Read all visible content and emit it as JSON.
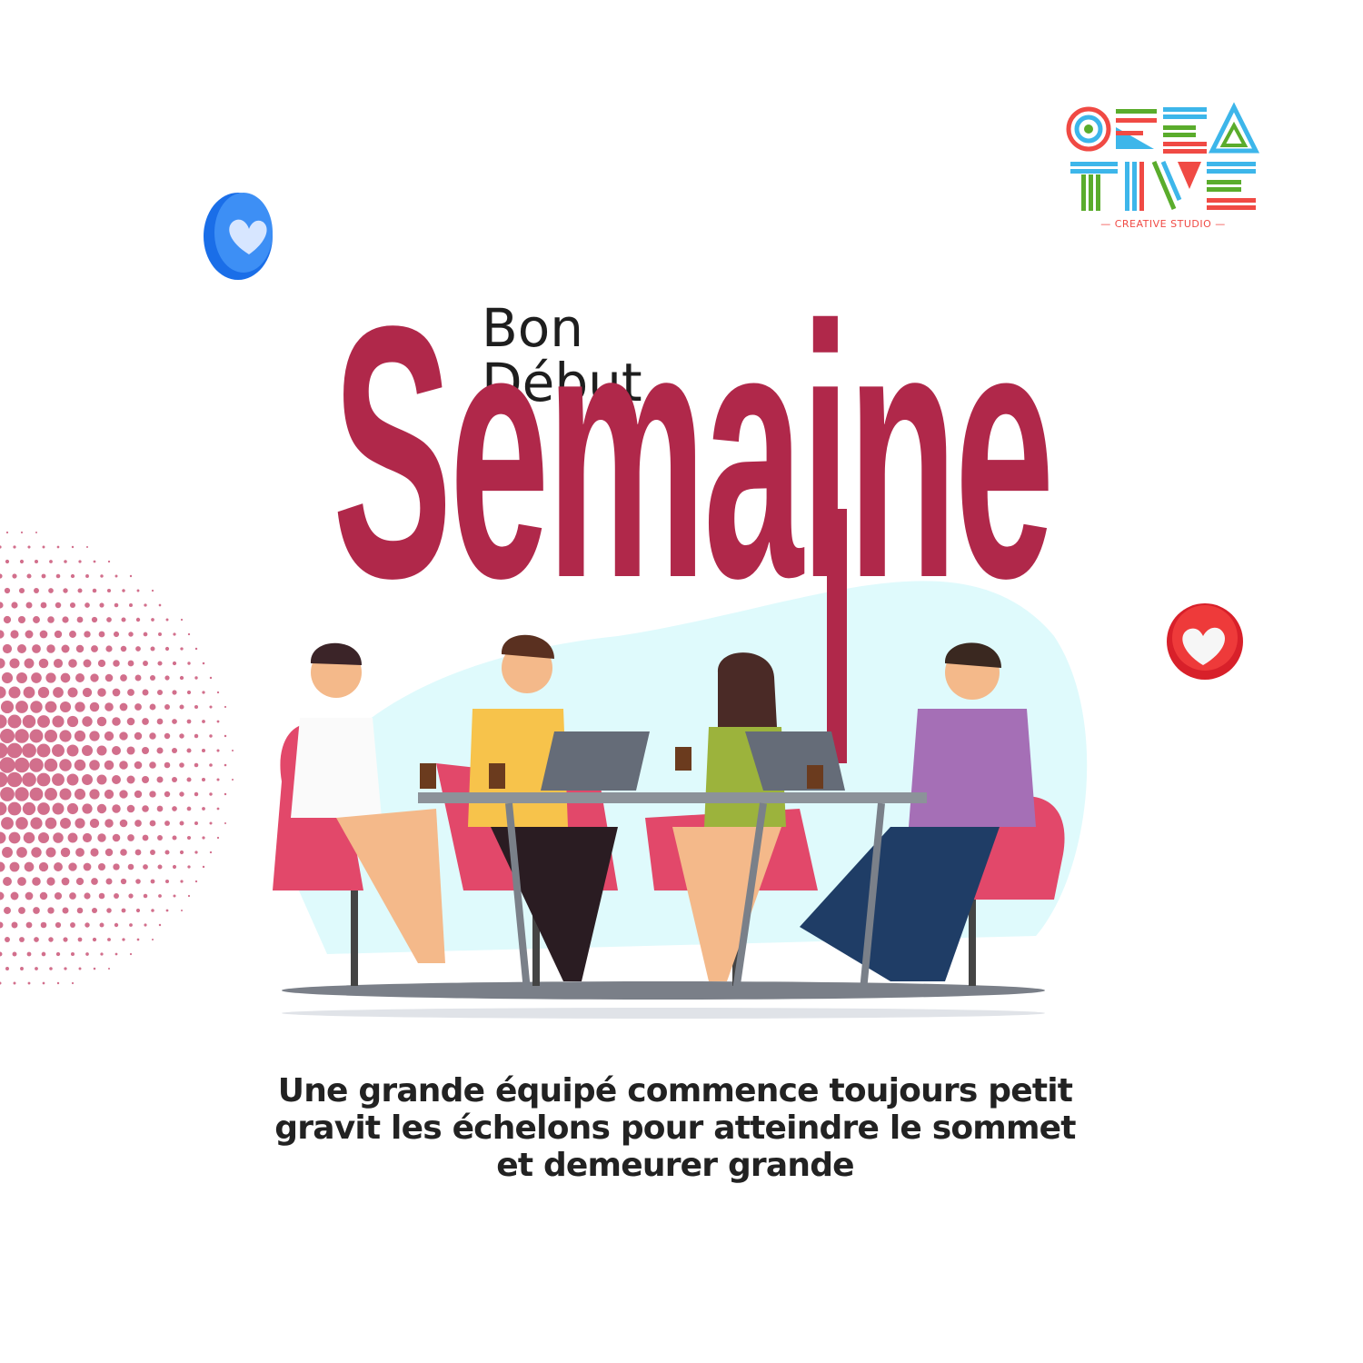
{
  "logo": {
    "wordmark_line1": "CREA",
    "wordmark_line2": "TIVE",
    "tagline": "CREATIVE STUDIO",
    "colors": [
      "#f04a44",
      "#3db6ea",
      "#5aac2c"
    ]
  },
  "headline": {
    "line1": "Bon",
    "line2": "Début",
    "main": "Semaine"
  },
  "caption": {
    "line1": "Une grande équipé commence toujours petit",
    "line2": "gravit les échelons pour atteindre le sommet",
    "line3": "et demeurer grande"
  },
  "decor": {
    "left_heart": "blue-heart-icon",
    "right_heart": "red-heart-icon"
  },
  "colors": {
    "accent": "#b0284a",
    "text": "#1e1e1e",
    "blob": "#dffafc",
    "chair": "#e2486a"
  }
}
